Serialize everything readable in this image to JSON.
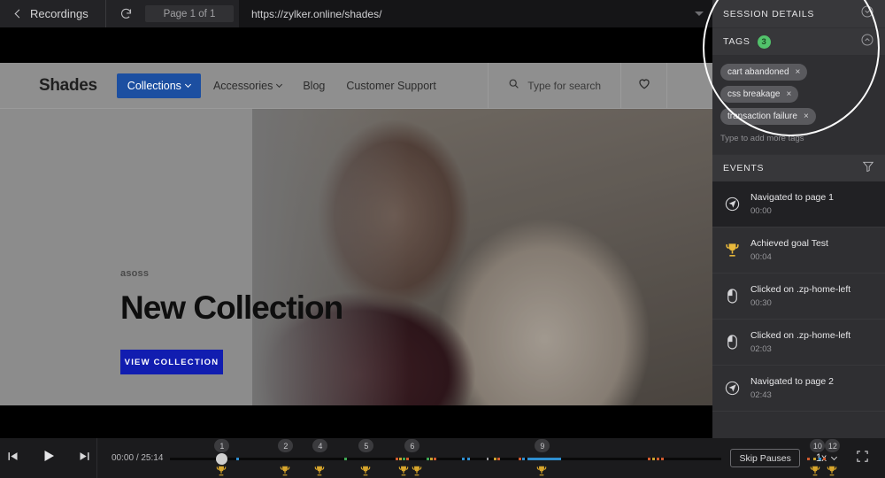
{
  "toolbar": {
    "back_label": "Recordings",
    "reload_icon": "reload-icon",
    "page_indicator": "Page 1 of 1",
    "url": "https://zylker.online/shades/"
  },
  "site": {
    "brand": "Shades",
    "nav": [
      {
        "label": "Collections",
        "has_caret": true,
        "active": true
      },
      {
        "label": "Accessories",
        "has_caret": true,
        "active": false
      },
      {
        "label": "Blog",
        "has_caret": false,
        "active": false
      },
      {
        "label": "Customer Support",
        "has_caret": false,
        "active": false
      }
    ],
    "search_placeholder": "Type for search",
    "hero": {
      "eyebrow": "asoss",
      "title": "New Collection",
      "cta": "VIEW COLLECTION"
    }
  },
  "panel": {
    "session_details": {
      "title": "SESSION DETAILS",
      "chevron": "chevron-down-icon"
    },
    "tags": {
      "title": "TAGS",
      "count": "3",
      "chevron": "chevron-up-icon",
      "items": [
        {
          "label": "cart abandoned",
          "remove": "×"
        },
        {
          "label": "css breakage",
          "remove": "×"
        },
        {
          "label": "transaction failure",
          "remove": "×"
        }
      ],
      "input_placeholder": "Type to add more tags"
    },
    "events": {
      "title": "EVENTS",
      "filter_icon": "filter-icon",
      "items": [
        {
          "icon": "navigate-icon",
          "name": "Navigated to page 1",
          "time": "00:00",
          "active": true
        },
        {
          "icon": "trophy-icon",
          "name": "Achieved goal Test",
          "time": "00:04",
          "active": false
        },
        {
          "icon": "mouse-click-icon",
          "name": "Clicked on .zp-home-left",
          "time": "00:30",
          "active": false
        },
        {
          "icon": "mouse-click-icon",
          "name": "Clicked on .zp-home-left",
          "time": "02:03",
          "active": false
        },
        {
          "icon": "navigate-icon",
          "name": "Navigated to page 2",
          "time": "02:43",
          "active": false
        }
      ]
    }
  },
  "player": {
    "prev_label": "skip-previous",
    "play_label": "play",
    "next_label": "skip-next",
    "current_time": "00:00",
    "separator": "/",
    "total_time": "25:14",
    "markers": [
      "1",
      "2",
      "4",
      "5",
      "6",
      "9",
      "10",
      "12"
    ],
    "skip_pauses": "Skip Pauses",
    "speed": "1x",
    "fullscreen_icon": "fullscreen-icon"
  }
}
